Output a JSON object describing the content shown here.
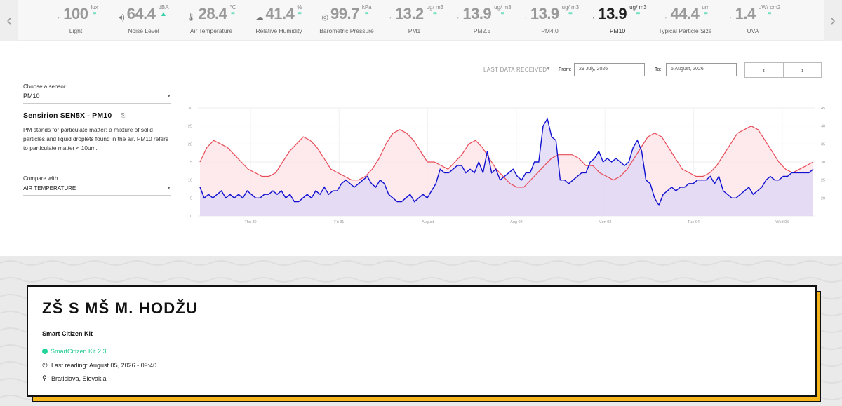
{
  "sensors_strip": {
    "items": [
      {
        "value": "100",
        "unit": "lux",
        "name": "Light",
        "icon": "arrow-right-icon",
        "trend": "≡",
        "active": false
      },
      {
        "value": "64.4",
        "unit": "dBA",
        "name": "Noise Level",
        "icon": "speaker-icon",
        "trend": "▲",
        "active": false
      },
      {
        "value": "28.4",
        "unit": "°C",
        "name": "Air Temperature",
        "icon": "thermometer-icon",
        "trend": "≡",
        "active": false
      },
      {
        "value": "41.4",
        "unit": "%",
        "name": "Relative Humidity",
        "icon": "cloud-rain-icon",
        "trend": "≡",
        "active": false
      },
      {
        "value": "99.7",
        "unit": "kPa",
        "name": "Barometric Pressure",
        "icon": "gauge-icon",
        "trend": "≡",
        "active": false
      },
      {
        "value": "13.2",
        "unit": "ug/ m3",
        "name": "PM1",
        "icon": "arrow-right-icon",
        "trend": "≡",
        "active": false
      },
      {
        "value": "13.9",
        "unit": "ug/ m3",
        "name": "PM2.5",
        "icon": "arrow-right-icon",
        "trend": "≡",
        "active": false
      },
      {
        "value": "13.9",
        "unit": "ug/ m3",
        "name": "PM4.0",
        "icon": "arrow-right-icon",
        "trend": "≡",
        "active": false
      },
      {
        "value": "13.9",
        "unit": "ug/ m3",
        "name": "PM10",
        "icon": "arrow-right-icon",
        "trend": "≡",
        "active": true
      },
      {
        "value": "44.4",
        "unit": "um",
        "name": "Typical Particle Size",
        "icon": "arrow-right-icon",
        "trend": "≡",
        "active": false
      },
      {
        "value": "1.4",
        "unit": "uW/ cm2",
        "name": "UVA",
        "icon": "arrow-right-icon",
        "trend": "≡",
        "active": false
      }
    ]
  },
  "controls": {
    "last_data_label": "LAST DATA RECEIVED",
    "from_label": "From:",
    "from_value": "29 July, 2026",
    "to_label": "To:",
    "to_value": "5 August, 2026",
    "prev_label": "‹",
    "next_label": "›"
  },
  "left_panel": {
    "choose_label": "Choose a sensor",
    "selected_sensor": "PM10",
    "sensor_title": "Sensirion SEN5X - PM10",
    "description": "PM stands for particulate matter: a mixture of solid particles and liquid droplets found in the air. PM10 refers to particulate matter < 10um.",
    "compare_label": "Compare with",
    "compare_value": "AIR TEMPERATURE"
  },
  "chart_data": {
    "type": "line",
    "x_ticks": [
      "Thu 30",
      "Fri 31",
      "August",
      "Aug 02",
      "Mon 03",
      "Tue 04",
      "Wed 05"
    ],
    "y_left_ticks": [
      0,
      5,
      10,
      15,
      20,
      25,
      30
    ],
    "y_right_ticks": [
      20,
      25,
      30,
      35,
      40,
      45
    ],
    "y_left_range": [
      0,
      30
    ],
    "y_right_range": [
      15,
      45
    ],
    "grid": true,
    "series": [
      {
        "color": "#1010d0",
        "fill": "#dcd6f5",
        "axis": "left",
        "values": [
          8,
          5,
          6,
          5,
          6,
          7,
          5,
          6,
          5,
          6,
          5,
          7,
          6,
          5,
          5,
          6,
          6,
          7,
          6,
          7,
          5,
          6,
          4,
          4,
          5,
          6,
          5,
          7,
          6,
          8,
          6,
          7,
          7,
          9,
          10,
          9,
          8,
          9,
          10,
          11,
          9,
          8,
          10,
          9,
          6,
          5,
          4,
          4,
          5,
          6,
          4,
          5,
          6,
          5,
          7,
          9,
          13,
          12,
          12,
          13,
          14,
          14,
          12,
          13,
          12,
          15,
          12,
          18,
          12,
          13,
          10,
          11,
          12,
          13,
          11,
          10,
          12,
          12,
          15,
          15,
          25,
          27,
          22,
          21,
          10,
          10,
          9,
          10,
          11,
          12,
          12,
          15,
          16,
          18,
          15,
          16,
          15,
          16,
          15,
          14,
          15,
          19,
          21,
          18,
          10,
          9,
          5,
          3,
          6,
          7,
          8,
          7,
          8,
          8,
          9,
          9,
          10,
          10,
          10,
          11,
          9,
          11,
          7,
          6,
          5,
          5,
          6,
          7,
          8,
          6,
          7,
          8,
          10,
          11,
          10,
          10,
          11,
          11,
          12,
          12,
          12,
          12,
          12,
          13
        ]
      },
      {
        "color": "#e84a57",
        "fill": "#fde3e7",
        "axis": "right",
        "values": [
          30,
          34,
          36,
          35,
          34,
          32,
          30,
          28,
          27,
          26,
          26,
          27,
          30,
          33,
          35,
          37,
          36,
          34,
          31,
          28,
          27,
          26,
          25,
          25,
          26,
          28,
          31,
          35,
          38,
          39,
          38,
          36,
          33,
          30,
          30,
          29,
          28,
          30,
          32,
          35,
          36,
          34,
          31,
          28,
          26,
          24,
          23,
          23,
          25,
          27,
          29,
          31,
          32,
          32,
          32,
          31,
          29,
          29,
          27,
          26,
          25,
          26,
          28,
          31,
          34,
          37,
          38,
          37,
          34,
          31,
          28,
          27,
          26,
          26,
          27,
          29,
          32,
          35,
          38,
          39,
          40,
          39,
          36,
          33,
          30,
          28,
          27,
          28,
          29,
          30
        ]
      }
    ]
  },
  "kit": {
    "name": "ZŠ S MŠ M. HODŽU",
    "type": "Smart Citizen Kit",
    "version": "SmartCitizen Kit 2.3",
    "last_reading": "Last reading: August 05, 2026 - 09:40",
    "location": "Bratislava, Slovakia"
  }
}
